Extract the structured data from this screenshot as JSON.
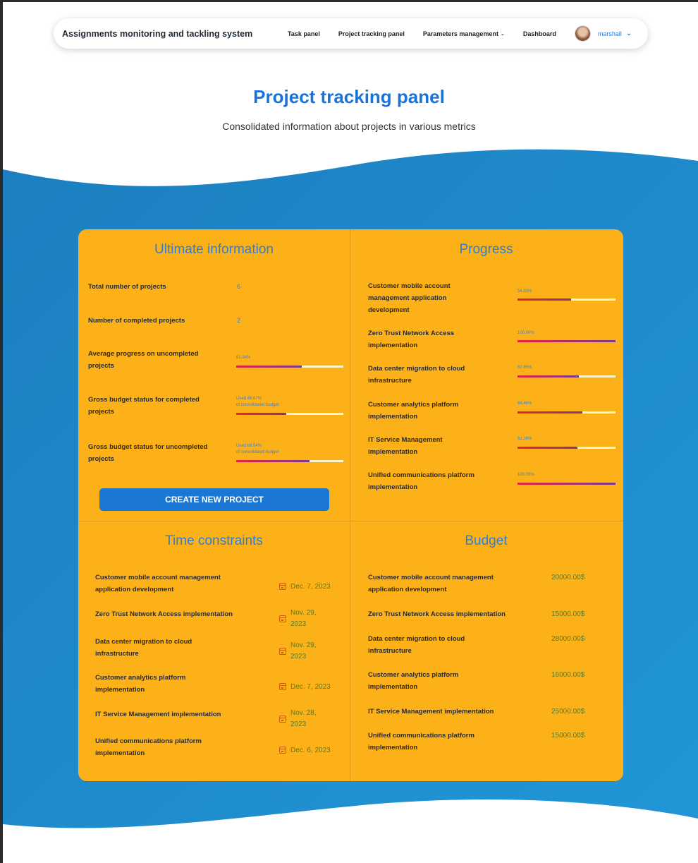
{
  "nav": {
    "brand": "Assignments monitoring and tackling system",
    "links": [
      "Task panel",
      "Project tracking panel",
      "Parameters management",
      "Dashboard"
    ],
    "user": "marshall"
  },
  "header": {
    "title": "Project tracking panel",
    "subtitle": "Consolidated information about projects in various metrics"
  },
  "ultimate": {
    "title": "Ultimate information",
    "total_label": "Total number of projects",
    "total_value": "6",
    "completed_label": "Number of completed projects",
    "completed_value": "2",
    "avg_label": "Average progress on uncompleted projects",
    "avg_value": "61.34%",
    "avg_fraction": 0.6134,
    "gross_completed_label": "Gross budget status for completed projects",
    "gross_completed_used": "Used 46.67%",
    "gross_completed_note": "of consolidated budget",
    "gross_completed_fraction": 0.4667,
    "gross_uncompleted_label": "Gross budget status for uncompleted projects",
    "gross_uncompleted_used": "Used 68.54%",
    "gross_uncompleted_note": "of consolidated budget",
    "gross_uncompleted_fraction": 0.6854,
    "create_button": "CREATE NEW PROJECT"
  },
  "progress": {
    "title": "Progress",
    "items": [
      {
        "name": "Customer mobile account management application development",
        "pct": "54.93%",
        "fraction": 0.5493
      },
      {
        "name": "Zero Trust Network Access implementation",
        "pct": "100.00%",
        "fraction": 1.0
      },
      {
        "name": "Data center migration to cloud infrastructure",
        "pct": "62.85%",
        "fraction": 0.6285
      },
      {
        "name": "Customer analytics platform implementation",
        "pct": "66.46%",
        "fraction": 0.6646
      },
      {
        "name": "IT Service Management implementation",
        "pct": "61.16%",
        "fraction": 0.6116
      },
      {
        "name": "Unified communications platform implementation",
        "pct": "100.00%",
        "fraction": 1.0
      }
    ]
  },
  "time": {
    "title": "Time constraints",
    "items": [
      {
        "name": "Customer mobile account management application development",
        "date": "Dec. 7, 2023"
      },
      {
        "name": "Zero Trust Network Access implementation",
        "date": "Nov. 29, 2023"
      },
      {
        "name": "Data center migration to cloud infrastructure",
        "date": "Nov. 29, 2023"
      },
      {
        "name": "Customer analytics platform implementation",
        "date": "Dec. 7, 2023"
      },
      {
        "name": "IT Service Management implementation",
        "date": "Nov. 28, 2023"
      },
      {
        "name": "Unified communications platform implementation",
        "date": "Dec. 6, 2023"
      }
    ]
  },
  "budget": {
    "title": "Budget",
    "items": [
      {
        "name": "Customer mobile account management application development",
        "amount": "20000.00$"
      },
      {
        "name": "Zero Trust Network Access implementation",
        "amount": "15000.00$"
      },
      {
        "name": "Data center migration to cloud infrastructure",
        "amount": "28000.00$"
      },
      {
        "name": "Customer analytics platform implementation",
        "amount": "16000.00$"
      },
      {
        "name": "IT Service Management implementation",
        "amount": "25000.00$"
      },
      {
        "name": "Unified communications platform implementation",
        "amount": "15000.00$"
      }
    ]
  },
  "colors": {
    "panel": "#fdb118",
    "accent_blue": "#1a73d9",
    "bar_fill_start": "#e8213a",
    "bar_fill_end": "#7a3a8a"
  }
}
